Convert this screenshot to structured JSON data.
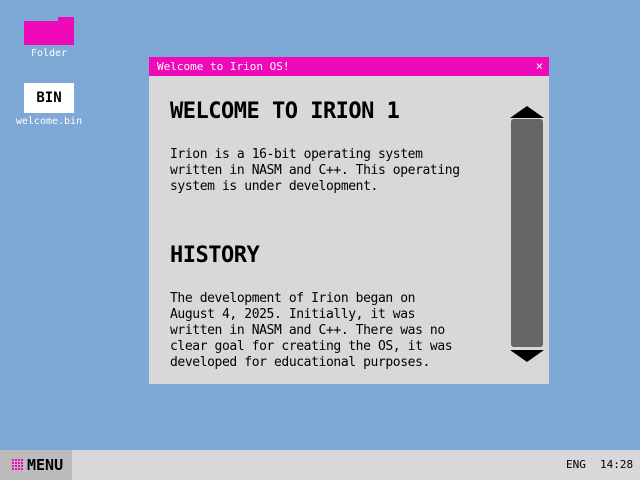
{
  "desktop": {
    "background_color": "#7ea8d6",
    "accent_color": "#ee0ab8",
    "icons": [
      {
        "label": "Folder",
        "icon": "folder-icon"
      },
      {
        "label": "welcome.bin",
        "badge": "BIN",
        "icon": "bin-file-icon"
      }
    ]
  },
  "window": {
    "title": "Welcome to Irion OS!",
    "close_glyph": "×",
    "heading1": "WELCOME TO IRION 1",
    "paragraph1": "Irion is a 16-bit operating system written in NASM and C++. This operating system is under development.",
    "heading2": "HISTORY",
    "paragraph2": "The development of Irion began on August 4, 2025. Initially, it was written in NASM and C++. There was no clear goal for creating the OS, it was developed for educational purposes."
  },
  "taskbar": {
    "menu_label": "MENU",
    "language": "ENG",
    "time": "14:28"
  }
}
